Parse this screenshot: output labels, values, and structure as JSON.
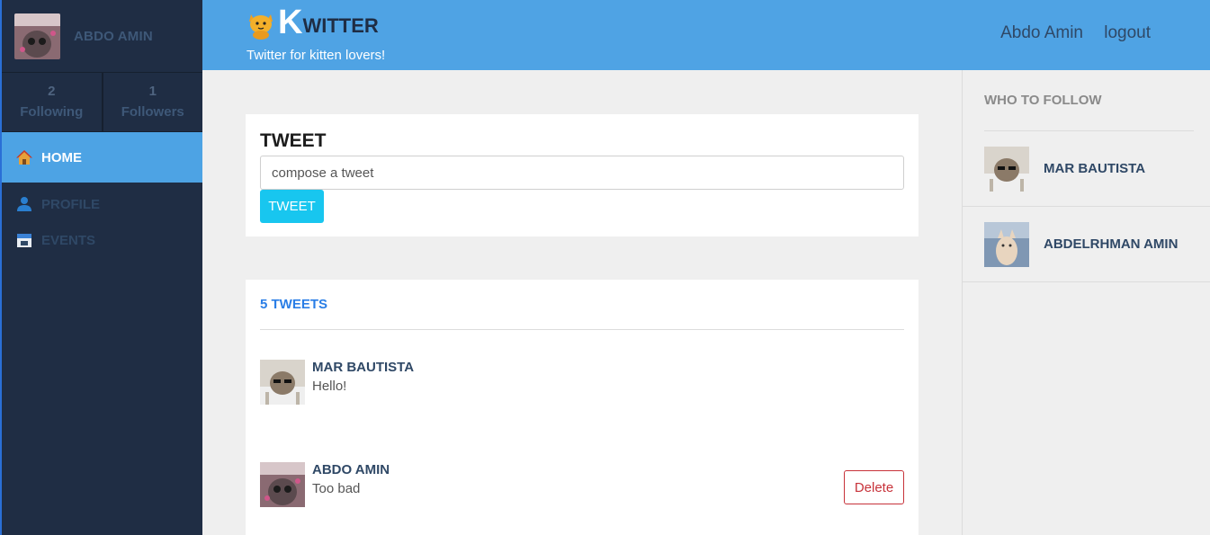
{
  "sidebar": {
    "user_name": "ABDO AMIN",
    "stats": [
      {
        "count": "2",
        "label": "Following"
      },
      {
        "count": "1",
        "label": "Followers"
      }
    ],
    "nav": [
      {
        "label": "HOME",
        "icon": "home-icon",
        "active": true
      },
      {
        "label": "PROFILE",
        "icon": "user-icon",
        "active": false
      },
      {
        "label": "EVENTS",
        "icon": "calendar-icon",
        "active": false
      }
    ]
  },
  "header": {
    "brand_first": "K",
    "brand_rest": "WITTER",
    "tagline": "Twitter for kitten lovers!",
    "user_link": "Abdo Amin",
    "logout_link": "logout"
  },
  "compose": {
    "title": "TWEET",
    "placeholder": "compose a tweet",
    "button": "TWEET"
  },
  "feed": {
    "count_label": "5 TWEETS",
    "tweets": [
      {
        "author": "MAR BAUTISTA",
        "text": "Hello!"
      },
      {
        "author": "ABDO AMIN",
        "text": "Too bad",
        "delete_label": "Delete"
      }
    ]
  },
  "who_to_follow": {
    "title": "WHO TO FOLLOW",
    "users": [
      {
        "name": "MAR BAUTISTA"
      },
      {
        "name": "ABDELRHMAN AMIN"
      }
    ]
  },
  "colors": {
    "header": "#4fa3e4",
    "sidebar": "#1f2d44",
    "accent": "#18c6ef",
    "danger": "#c7323a"
  }
}
